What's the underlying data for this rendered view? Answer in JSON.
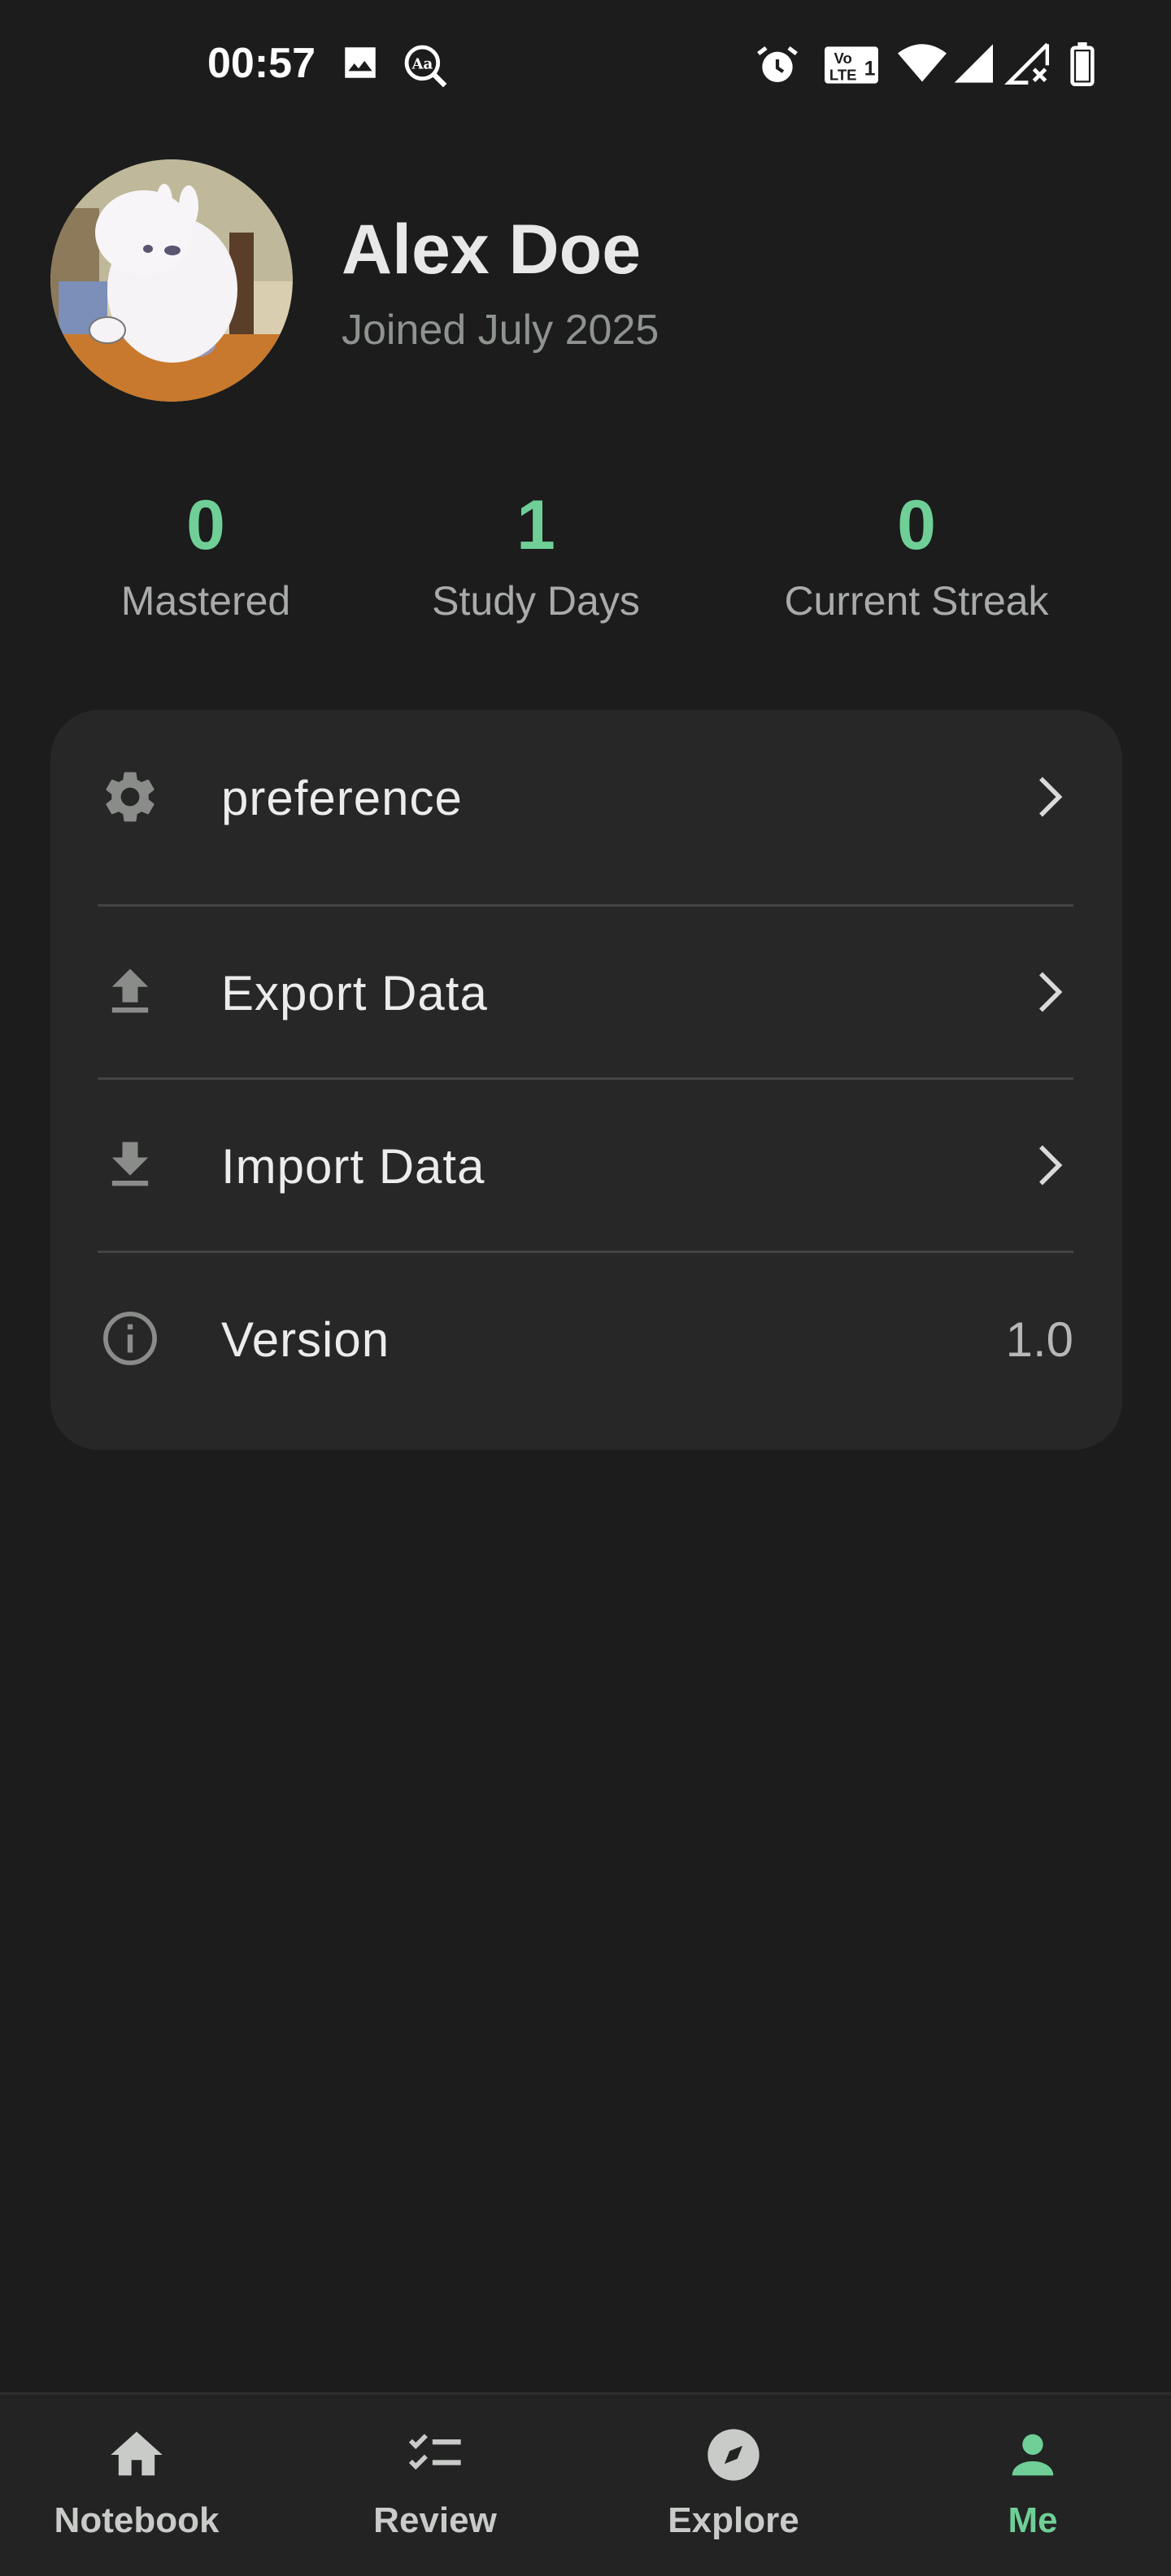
{
  "status_bar": {
    "time": "00:57",
    "icons": [
      "image-icon",
      "dictionary-search-icon",
      "alarm-icon",
      "volte-icon",
      "wifi-icon",
      "signal-icon",
      "signal-no-service-icon",
      "battery-icon"
    ],
    "volte_label": "Vo LTE 1"
  },
  "profile": {
    "name": "Alex Doe",
    "joined": "Joined July 2025"
  },
  "stats": [
    {
      "value": "0",
      "label": "Mastered"
    },
    {
      "value": "1",
      "label": "Study Days"
    },
    {
      "value": "0",
      "label": "Current Streak"
    }
  ],
  "menu": [
    {
      "icon": "gear-icon",
      "label": "preference"
    },
    {
      "icon": "upload-icon",
      "label": "Export Data"
    },
    {
      "icon": "download-icon",
      "label": "Import Data"
    },
    {
      "icon": "info-icon",
      "label": "Version",
      "value": "1.0"
    }
  ],
  "bottom_nav": [
    {
      "icon": "home-icon",
      "label": "Notebook",
      "active": false
    },
    {
      "icon": "checklist-icon",
      "label": "Review",
      "active": false
    },
    {
      "icon": "compass-icon",
      "label": "Explore",
      "active": false
    },
    {
      "icon": "person-icon",
      "label": "Me",
      "active": true
    }
  ],
  "colors": {
    "background": "#1b1c1b",
    "card": "#262726",
    "accent": "#6fcf97",
    "text_primary": "#e8e8e8",
    "text_secondary": "#8f9390"
  }
}
